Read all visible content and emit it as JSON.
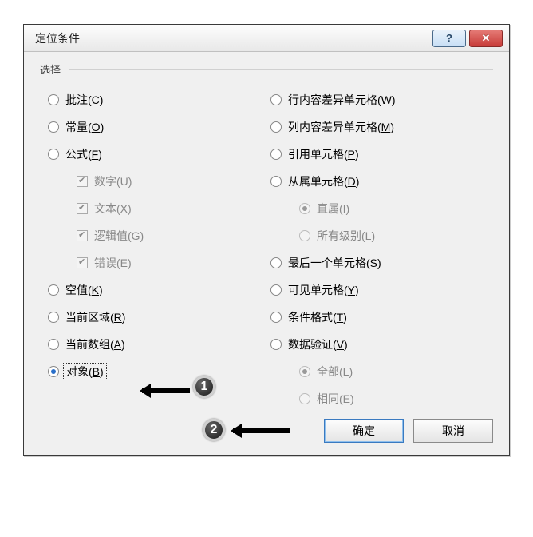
{
  "title": "定位条件",
  "group": "选择",
  "leftOptions": [
    {
      "label": "批注(",
      "hot": "C",
      "tail": ")",
      "type": "radio"
    },
    {
      "label": "常量(",
      "hot": "O",
      "tail": ")",
      "type": "radio"
    },
    {
      "label": "公式(",
      "hot": "F",
      "tail": ")",
      "type": "radio"
    },
    {
      "label": "数字(U)",
      "type": "checkbox",
      "indent": 1,
      "disabled": true,
      "checked": true
    },
    {
      "label": "文本(X)",
      "type": "checkbox",
      "indent": 1,
      "disabled": true,
      "checked": true
    },
    {
      "label": "逻辑值(G)",
      "type": "checkbox",
      "indent": 1,
      "disabled": true,
      "checked": true
    },
    {
      "label": "错误(E)",
      "type": "checkbox",
      "indent": 1,
      "disabled": true,
      "checked": true
    },
    {
      "label": "空值(",
      "hot": "K",
      "tail": ")",
      "type": "radio"
    },
    {
      "label": "当前区域(",
      "hot": "R",
      "tail": ")",
      "type": "radio"
    },
    {
      "label": "当前数组(",
      "hot": "A",
      "tail": ")",
      "type": "radio"
    },
    {
      "label": "对象(",
      "hot": "B",
      "tail": ")",
      "type": "radio",
      "checked": true,
      "focused": true
    }
  ],
  "rightOptions": [
    {
      "label": "行内容差异单元格(",
      "hot": "W",
      "tail": ")",
      "type": "radio"
    },
    {
      "label": "列内容差异单元格(",
      "hot": "M",
      "tail": ")",
      "type": "radio"
    },
    {
      "label": "引用单元格(",
      "hot": "P",
      "tail": ")",
      "type": "radio"
    },
    {
      "label": "从属单元格(",
      "hot": "D",
      "tail": ")",
      "type": "radio"
    },
    {
      "label": "直属(I)",
      "type": "radio",
      "indent": 1,
      "disabled": true,
      "checked": true
    },
    {
      "label": "所有级别(L)",
      "type": "radio",
      "indent": 1,
      "disabled": true
    },
    {
      "label": "最后一个单元格(",
      "hot": "S",
      "tail": ")",
      "type": "radio"
    },
    {
      "label": "可见单元格(",
      "hot": "Y",
      "tail": ")",
      "type": "radio"
    },
    {
      "label": "条件格式(",
      "hot": "T",
      "tail": ")",
      "type": "radio"
    },
    {
      "label": "数据验证(",
      "hot": "V",
      "tail": ")",
      "type": "radio"
    },
    {
      "label": "全部(L)",
      "type": "radio",
      "indent": 1,
      "disabled": true,
      "checked": true
    },
    {
      "label": "相同(E)",
      "type": "radio",
      "indent": 1,
      "disabled": true
    }
  ],
  "buttons": {
    "ok": "确定",
    "cancel": "取消"
  },
  "callouts": [
    "1",
    "2"
  ]
}
